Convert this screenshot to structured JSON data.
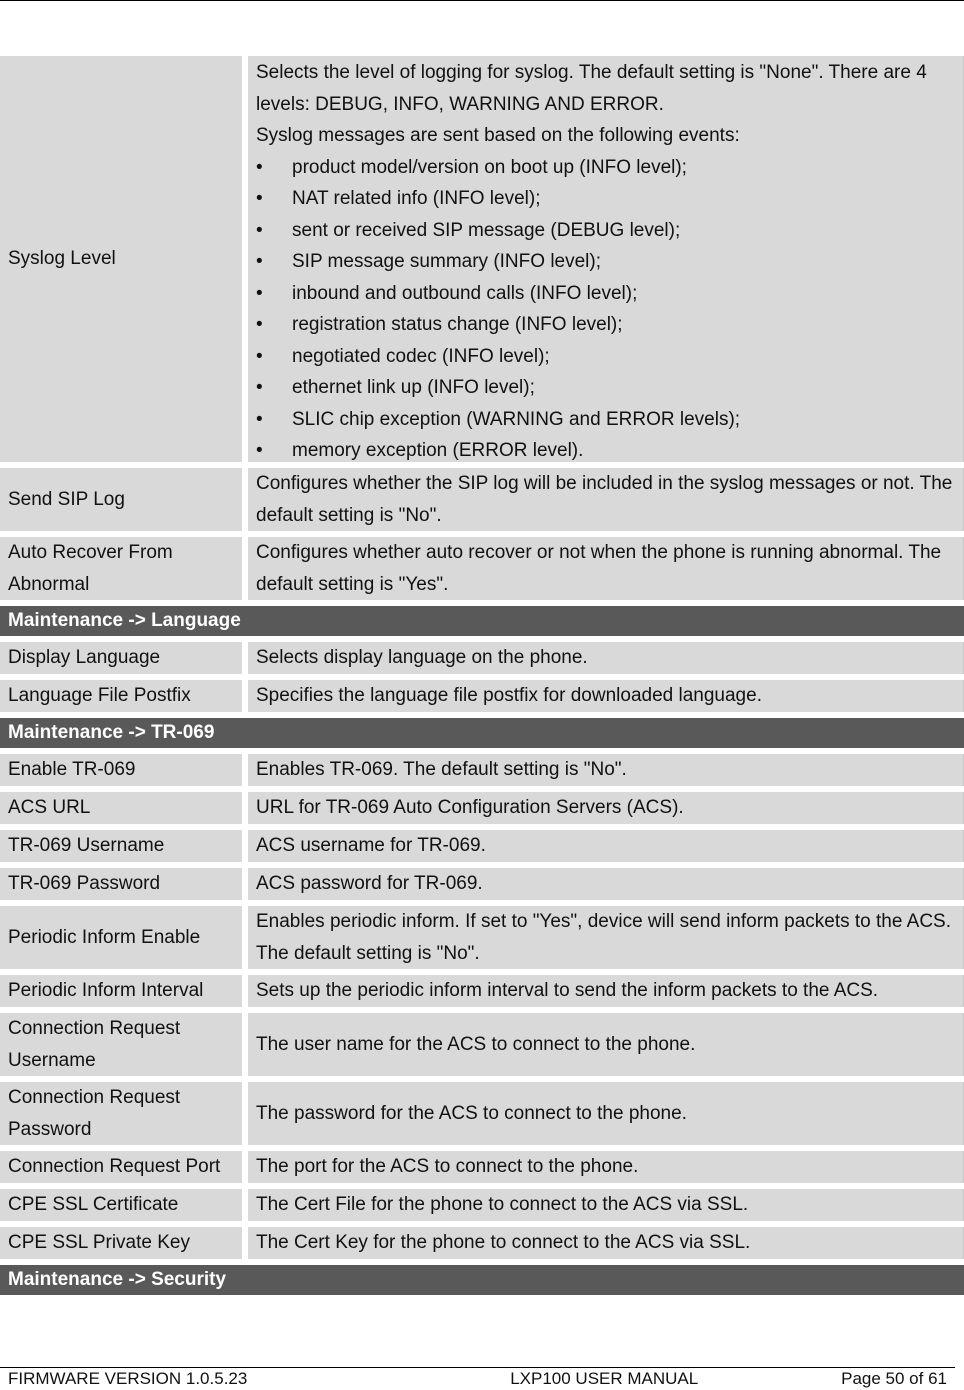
{
  "syslog": {
    "label": "Syslog Level",
    "intro": "Selects the level of logging for syslog. The default setting is \"None\". There are 4 levels: DEBUG, INFO, WARNING AND ERROR.",
    "events_intro": "Syslog messages are sent based on the following events:",
    "events": [
      "product model/version on boot up (INFO level);",
      "NAT related info (INFO level);",
      "sent or received SIP message (DEBUG level);",
      "SIP message summary (INFO level);",
      "inbound and outbound calls (INFO level);",
      "registration status change (INFO level);",
      "negotiated codec (INFO level);",
      "ethernet link up (INFO level);",
      "SLIC chip exception (WARNING and ERROR levels);",
      "memory exception (ERROR level)."
    ]
  },
  "rows_a": [
    {
      "label": "Send SIP Log",
      "desc": "Configures whether the SIP log will be included in the syslog messages or not. The default setting is \"No\"."
    },
    {
      "label": "Auto Recover From Abnormal",
      "desc": "Configures whether auto recover or not when the phone is running abnormal. The default setting is \"Yes\"."
    }
  ],
  "sections": {
    "language": "Maintenance -> Language",
    "tr069": "Maintenance -> TR-069",
    "security": "Maintenance -> Security"
  },
  "language_rows": [
    {
      "label": "Display Language",
      "desc": "Selects display language on the phone."
    },
    {
      "label": "Language File Postfix",
      "desc": "Specifies the language file postfix for downloaded language."
    }
  ],
  "tr069_rows": [
    {
      "label": "Enable TR-069",
      "desc": "Enables TR-069. The default setting is \"No\"."
    },
    {
      "label": "ACS URL",
      "desc": "URL for TR-069 Auto Configuration Servers (ACS)."
    },
    {
      "label": "TR-069 Username",
      "desc": "ACS username for TR-069."
    },
    {
      "label": "TR-069 Password",
      "desc": "ACS password for TR-069."
    },
    {
      "label": "Periodic Inform Enable",
      "desc": "Enables periodic inform. If set to \"Yes\", device will send inform packets to the ACS. The default setting is \"No\"."
    },
    {
      "label": "Periodic Inform Interval",
      "desc": "Sets up the periodic inform interval to send the inform packets to the ACS."
    },
    {
      "label": "Connection Request Username",
      "desc": "The user name for the ACS to connect to the phone."
    },
    {
      "label": "Connection Request Password",
      "desc": "The password for the ACS to connect to the phone."
    },
    {
      "label": "Connection Request Port",
      "desc": "The port for the ACS to connect to the phone."
    },
    {
      "label": "CPE SSL Certificate",
      "desc": "The Cert File for the phone to connect to the ACS via SSL."
    },
    {
      "label": "CPE SSL Private Key",
      "desc": "The Cert Key for the phone to connect to the ACS via SSL."
    }
  ],
  "footer": {
    "firmware": "FIRMWARE VERSION 1.0.5.23",
    "manual": "LXP100 USER MANUAL",
    "page": "Page 50 of 61"
  }
}
